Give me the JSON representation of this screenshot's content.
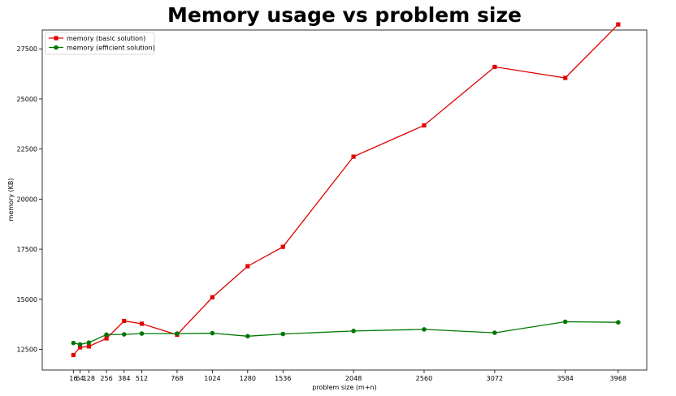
{
  "chart_data": {
    "type": "line",
    "title": "Memory usage vs problem size",
    "xlabel": "problem size (m+n)",
    "ylabel": "memory (KB)",
    "x": [
      16,
      64,
      128,
      256,
      384,
      512,
      768,
      1024,
      1280,
      1536,
      2048,
      2560,
      3072,
      3584,
      3968
    ],
    "x_tick_labels": [
      "16",
      "64",
      "128",
      "256",
      "384",
      "512",
      "768",
      "1024",
      "1280",
      "1536",
      "2048",
      "2560",
      "3072",
      "3584",
      "3968"
    ],
    "y_ticks": [
      12500,
      15000,
      17500,
      20000,
      22500,
      25000,
      27500
    ],
    "y_tick_labels": [
      "12500",
      "15000",
      "17500",
      "20000",
      "22500",
      "25000",
      "27500"
    ],
    "xlim": [
      -210,
      4175
    ],
    "ylim": [
      11470,
      28440
    ],
    "grid": false,
    "legend_position": "top-left",
    "series": [
      {
        "name": "memory (basic solution)",
        "color": "#e00000",
        "marker": "square",
        "values": [
          12220,
          12600,
          12650,
          13050,
          13920,
          13780,
          13230,
          15100,
          16650,
          17620,
          22120,
          23680,
          26600,
          26050,
          28720
        ]
      },
      {
        "name": "memory (efficient solution)",
        "color": "#007700",
        "marker": "circle",
        "values": [
          12820,
          12750,
          12840,
          13240,
          13250,
          13290,
          13290,
          13310,
          13160,
          13270,
          13420,
          13500,
          13330,
          13880,
          13850
        ]
      }
    ]
  }
}
